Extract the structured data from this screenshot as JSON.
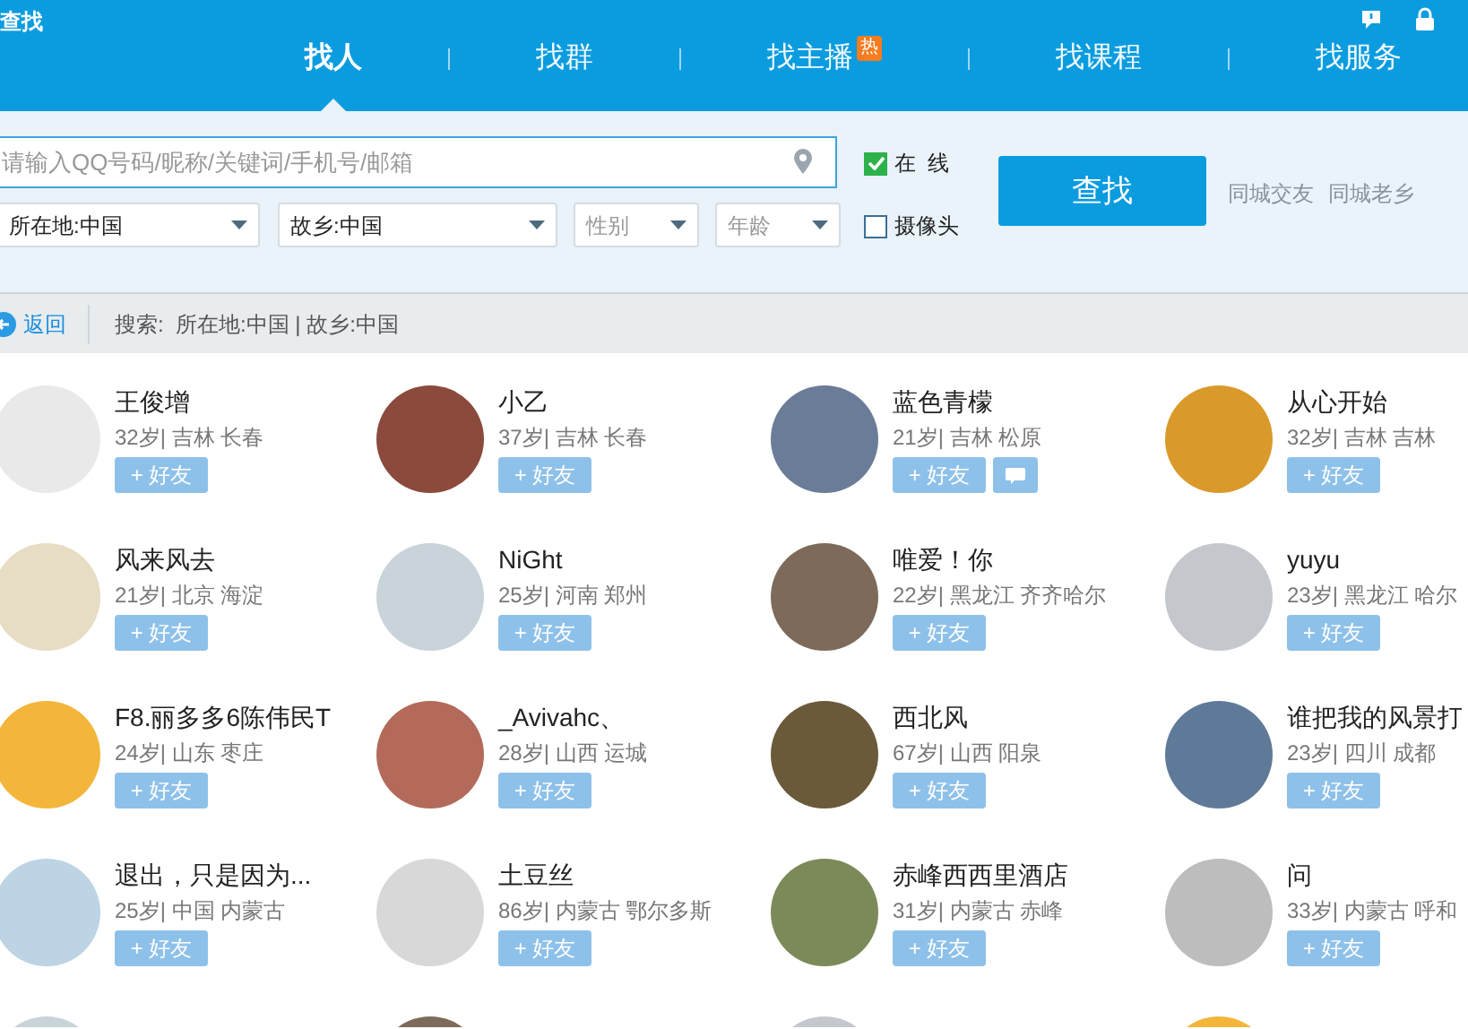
{
  "window": {
    "title": "查找"
  },
  "tabs": [
    {
      "label": "找人",
      "selected": true,
      "hot": false
    },
    {
      "label": "找群",
      "selected": false,
      "hot": false
    },
    {
      "label": "找主播",
      "selected": false,
      "hot": true,
      "badge": "热"
    },
    {
      "label": "找课程",
      "selected": false,
      "hot": false
    },
    {
      "label": "找服务",
      "selected": false,
      "hot": false
    }
  ],
  "search": {
    "placeholder": "请输入QQ号码/昵称/关键词/手机号/邮箱"
  },
  "filters": [
    {
      "value": "所在地:中国",
      "placeholder": false
    },
    {
      "value": "故乡:中国",
      "placeholder": false
    },
    {
      "value": "性别",
      "placeholder": true
    },
    {
      "value": "年龄",
      "placeholder": true
    }
  ],
  "checkboxes": [
    {
      "label": "在  线",
      "checked": true
    },
    {
      "label": "摄像头",
      "checked": false
    }
  ],
  "search_button": "查找",
  "links": [
    "同城交友",
    "同城老乡"
  ],
  "back": "返回",
  "search_summary": "搜索:  所在地:中国 | 故乡:中国",
  "people": [
    {
      "name": "王俊增",
      "info": "32岁| 吉林 长春",
      "add": "+ 好友",
      "message_button": false
    },
    {
      "name": "小乙",
      "info": "37岁| 吉林 长春",
      "add": "+ 好友",
      "message_button": false
    },
    {
      "name": "蓝色青檬",
      "info": "21岁| 吉林 松原",
      "add": "+ 好友",
      "message_button": true
    },
    {
      "name": "从心开始",
      "info": "32岁| 吉林 吉林",
      "add": "+ 好友",
      "message_button": false
    },
    {
      "name": "风来风去",
      "info": "21岁| 北京 海淀",
      "add": "+ 好友",
      "message_button": false
    },
    {
      "name": "NiGht",
      "info": "25岁| 河南 郑州",
      "add": "+ 好友",
      "message_button": false
    },
    {
      "name": "唯爱！你",
      "info": "22岁| 黑龙江 齐齐哈尔",
      "add": "+ 好友",
      "message_button": false
    },
    {
      "name": "yuyu",
      "info": "23岁| 黑龙江 哈尔",
      "add": "+ 好友",
      "message_button": false
    },
    {
      "name": "F8.丽多多6陈伟民T",
      "info": "24岁| 山东 枣庄",
      "add": "+ 好友",
      "message_button": false
    },
    {
      "name": "_Avivahc、",
      "info": "28岁| 山西 运城",
      "add": "+ 好友",
      "message_button": false
    },
    {
      "name": "西北风",
      "info": "67岁| 山西 阳泉",
      "add": "+ 好友",
      "message_button": false
    },
    {
      "name": "谁把我的风景打",
      "info": "23岁| 四川 成都",
      "add": "+ 好友",
      "message_button": false
    },
    {
      "name": "退出，只是因为...",
      "info": "25岁| 中国 内蒙古",
      "add": "+ 好友",
      "message_button": false
    },
    {
      "name": "土豆丝",
      "info": "86岁| 内蒙古 鄂尔多斯",
      "add": "+ 好友",
      "message_button": false
    },
    {
      "name": "赤峰西西里酒店",
      "info": "31岁| 内蒙古 赤峰",
      "add": "+ 好友",
      "message_button": false
    },
    {
      "name": "问",
      "info": "33岁| 内蒙古 呼和",
      "add": "+ 好友",
      "message_button": false
    }
  ]
}
